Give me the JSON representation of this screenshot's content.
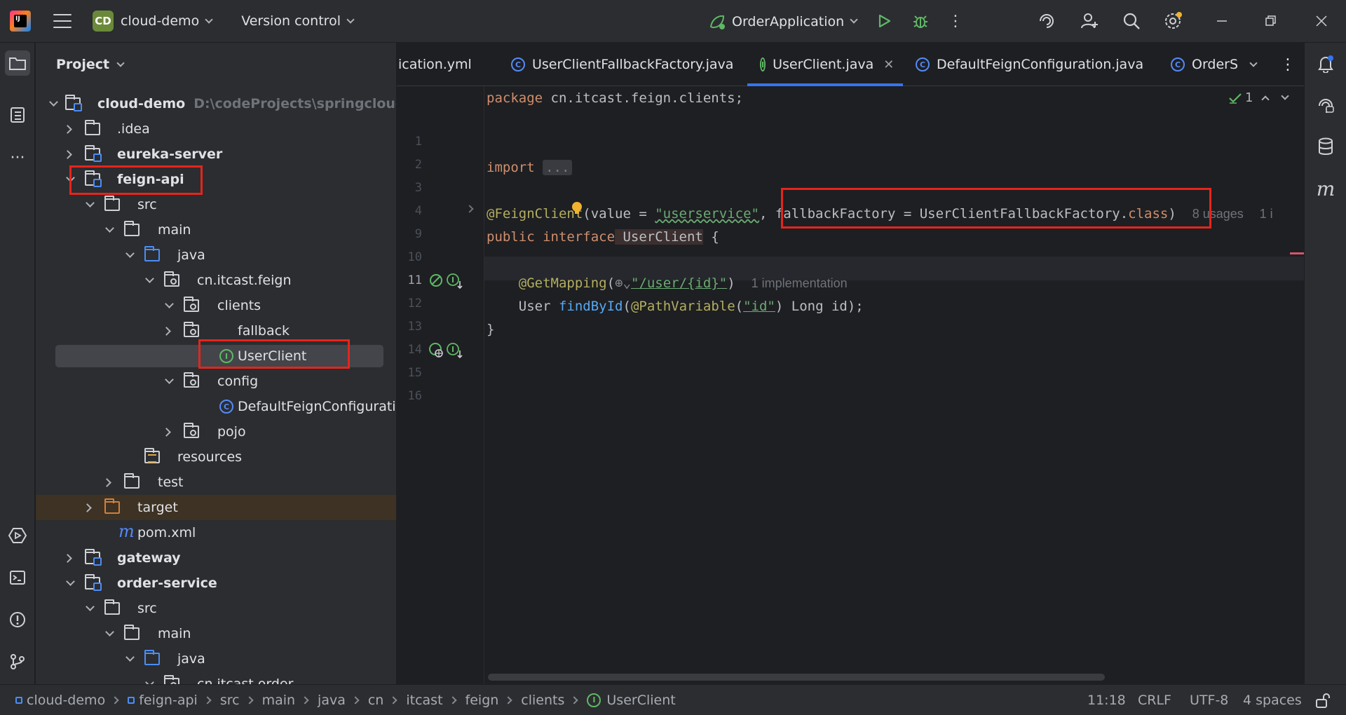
{
  "titlebar": {
    "project_badge": "CD",
    "project_name": "cloud-demo",
    "vcs_label": "Version control",
    "run_config": "OrderApplication"
  },
  "project_panel": {
    "title": "Project",
    "tree": [
      {
        "label": "cloud-demo",
        "path": "D:\\codeProjects\\springcloudProject"
      },
      {
        "label": ".idea"
      },
      {
        "label": "eureka-server"
      },
      {
        "label": "feign-api"
      },
      {
        "label": "src"
      },
      {
        "label": "main"
      },
      {
        "label": "java"
      },
      {
        "label": "cn.itcast.feign"
      },
      {
        "label": "clients"
      },
      {
        "label": "fallback"
      },
      {
        "label": "UserClient"
      },
      {
        "label": "config"
      },
      {
        "label": "DefaultFeignConfiguration"
      },
      {
        "label": "pojo"
      },
      {
        "label": "resources"
      },
      {
        "label": "test"
      },
      {
        "label": "target"
      },
      {
        "label": "pom.xml"
      },
      {
        "label": "gateway"
      },
      {
        "label": "order-service"
      },
      {
        "label": "src"
      },
      {
        "label": "main"
      },
      {
        "label": "java"
      },
      {
        "label": "cn.itcast.order"
      }
    ]
  },
  "tabs": [
    {
      "label": "ication.yml"
    },
    {
      "label": "UserClientFallbackFactory.java"
    },
    {
      "label": "UserClient.java",
      "active": true
    },
    {
      "label": "DefaultFeignConfiguration.java"
    },
    {
      "label": "OrderS"
    }
  ],
  "editor": {
    "line_numbers": [
      "1",
      "2",
      "3",
      "4",
      "9",
      "10",
      "11",
      "12",
      "13",
      "14",
      "15",
      "16"
    ],
    "inspection_count": "1",
    "line1": {
      "kw": "package",
      "rest": " cn.itcast.feign.clients;"
    },
    "line4": {
      "kw": "import",
      "folded": "..."
    },
    "line10": {
      "ann": "@FeignClient",
      "p1": "(value = ",
      "str": "\"userservice\"",
      "p2": ", fallbackFactory = UserClientFallbackFactory.",
      "kw2": "class",
      "p3": ")",
      "hint_usages": "8 usages",
      "hint_impl": "1 i"
    },
    "line11": {
      "kw": "public interface",
      "name": " UserClient",
      "rest": " {"
    },
    "line13": {
      "ann": "@GetMapping",
      "p1": "(",
      "str": "\"/user/{id}\"",
      "p2": ")",
      "hint": "1 implementation"
    },
    "line14": {
      "type": "User ",
      "fn": "findById",
      "p1": "(",
      "ann": "@PathVariable",
      "p2": "(",
      "str": "\"id\"",
      "p3": ") Long id);"
    },
    "line15": "}"
  },
  "statusbar": {
    "breadcrumbs": [
      "cloud-demo",
      "feign-api",
      "src",
      "main",
      "java",
      "cn",
      "itcast",
      "feign",
      "clients",
      "UserClient"
    ],
    "position": "11:18",
    "line_ending": "CRLF",
    "encoding": "UTF-8",
    "indent": "4 spaces"
  },
  "colors": {
    "accent": "#3574f0",
    "highlight_box": "#e5251c",
    "keyword": "#cf8e6d",
    "annotation": "#b3ae60",
    "string": "#6aab73"
  }
}
